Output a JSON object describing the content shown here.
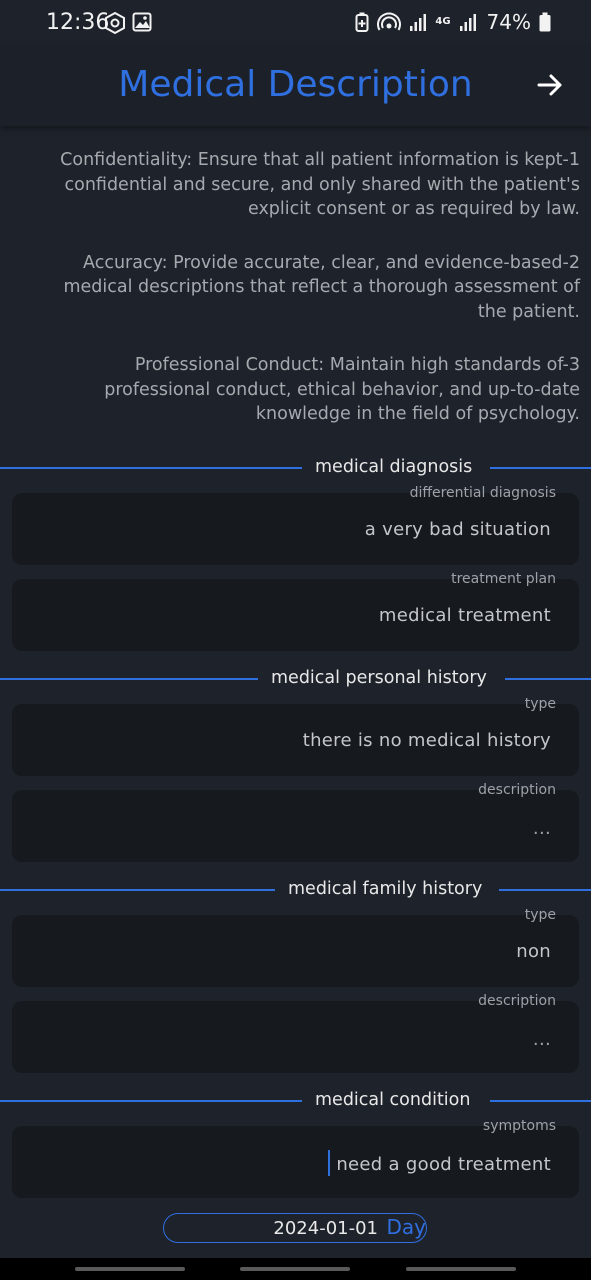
{
  "status_bar": {
    "time": "12:36",
    "network": "4G",
    "battery": "74%",
    "icons": [
      "shield-gear-icon",
      "image-icon",
      "battery-saver-icon",
      "hotspot-icon",
      "signal-icon",
      "signal-icon",
      "battery-icon"
    ]
  },
  "header": {
    "title": "Medical Description",
    "forward_icon": "arrow-right-icon",
    "title_color": "#2f6fe0"
  },
  "guidelines": [
    {
      "text": "Confidentiality: Ensure that all patient information is kept-1 confidential and secure, and only shared with the patient's explicit consent or as required by law."
    },
    {
      "text": "Accuracy: Provide accurate, clear, and evidence-based-2 medical descriptions that reflect a thorough assessment of the patient."
    },
    {
      "text": "Professional Conduct: Maintain high standards of-3 professional conduct, ethical behavior, and up-to-date knowledge in the field of psychology."
    }
  ],
  "sections": {
    "diagnosis": {
      "title": "medical diagnosis",
      "differential": {
        "label": "differential diagnosis",
        "value": "a very bad situation"
      },
      "treatment": {
        "label": "treatment plan",
        "value": "medical treatment"
      }
    },
    "personal_history": {
      "title": "medical personal history",
      "type": {
        "label": "type",
        "value": "there is no medical history"
      },
      "description": {
        "label": "description",
        "value": "..."
      }
    },
    "family_history": {
      "title": "medical family history",
      "type": {
        "label": "type",
        "value": "non"
      },
      "description": {
        "label": "description",
        "value": "..."
      }
    },
    "condition": {
      "title": "medical condition",
      "symptoms": {
        "label": "symptoms",
        "value": "need a good treatment"
      }
    }
  },
  "date_field": {
    "value": "2024-01-01",
    "unit": "Day"
  },
  "colors": {
    "accent": "#2f6fe0",
    "background": "#1e232b",
    "field_bg": "#16191e"
  }
}
